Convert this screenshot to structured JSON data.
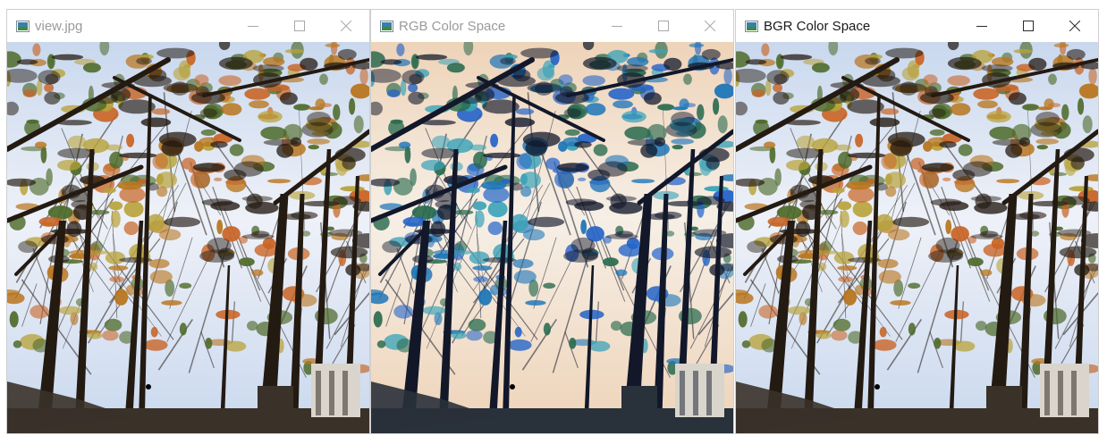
{
  "windows": [
    {
      "id": "view",
      "title": "view.jpg",
      "state": "inactive",
      "image_variant": "original",
      "controls": [
        "minimize-icon",
        "maximize-icon",
        "close-icon"
      ]
    },
    {
      "id": "rgb",
      "title": "RGB Color Space",
      "state": "inactive",
      "image_variant": "channel-swapped",
      "controls": [
        "minimize-icon",
        "maximize-icon",
        "close-icon"
      ]
    },
    {
      "id": "bgr",
      "title": "BGR Color Space",
      "state": "active",
      "image_variant": "original",
      "controls": [
        "minimize-icon",
        "maximize-icon",
        "close-icon"
      ]
    }
  ],
  "palettes": {
    "original": {
      "sky": "#eef1f8",
      "sky_tint": "#c9d8ee",
      "foliage_warm": "#b8761f",
      "foliage_orange": "#c86425",
      "foliage_green": "#4e6a2a",
      "foliage_yellow": "#b8a23a",
      "trunk": "#231a12",
      "ground": "#3a3129"
    },
    "channel-swapped": {
      "sky": "#f6efe6",
      "sky_tint": "#eed3b8",
      "foliage_warm": "#1f76b8",
      "foliage_orange": "#2564c8",
      "foliage_green": "#2a6a4e",
      "foliage_yellow": "#3aa2b8",
      "trunk": "#12182a",
      "ground": "#29313a"
    }
  }
}
